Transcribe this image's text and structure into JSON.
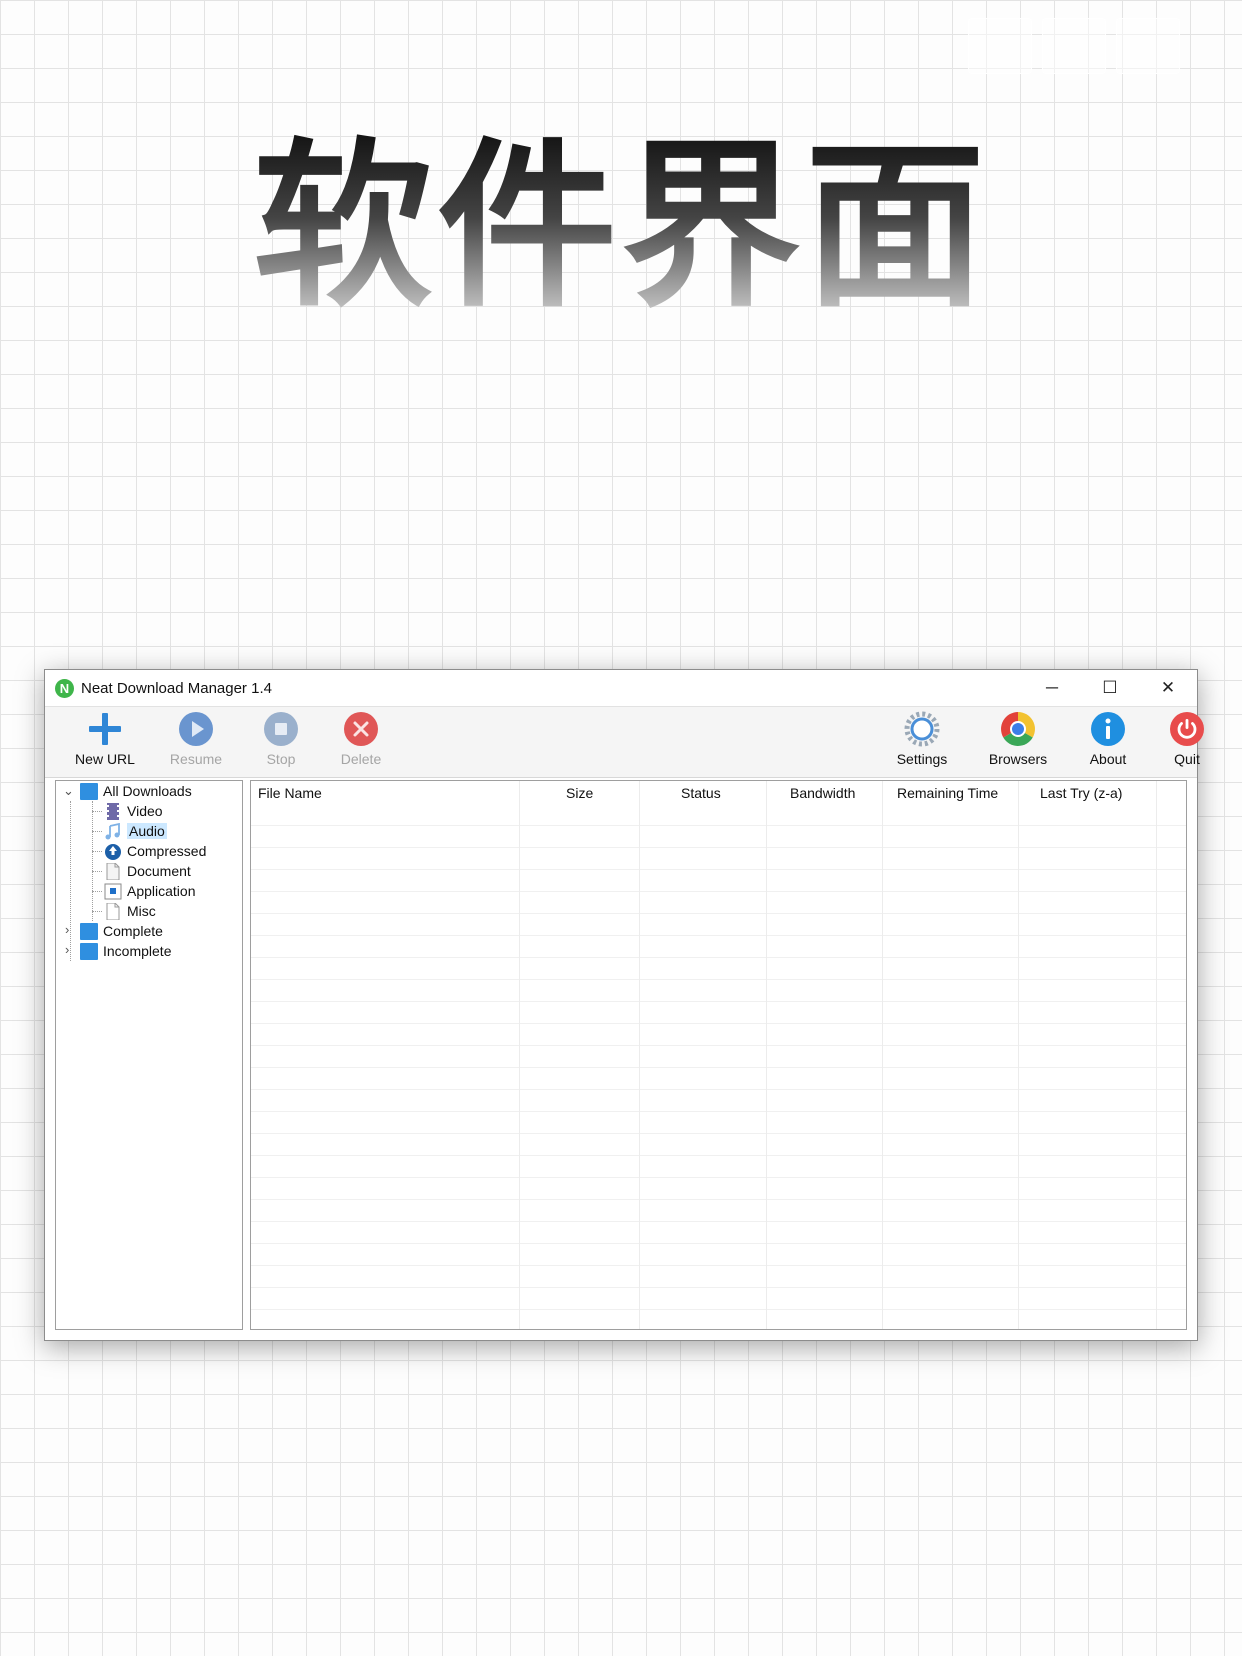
{
  "banner": {
    "title": "软件界面"
  },
  "window": {
    "title": "Neat Download Manager 1.4",
    "app_icon_letter": "N",
    "controls": {
      "minimize": "─",
      "maximize": "☐",
      "close": "✕"
    }
  },
  "toolbar": {
    "new_url": "New URL",
    "resume": "Resume",
    "stop": "Stop",
    "delete": "Delete",
    "settings": "Settings",
    "browsers": "Browsers",
    "about": "About",
    "quit": "Quit"
  },
  "tree": {
    "all_downloads": "All Downloads",
    "video": "Video",
    "audio": "Audio",
    "compressed": "Compressed",
    "document": "Document",
    "application": "Application",
    "misc": "Misc",
    "complete": "Complete",
    "incomplete": "Incomplete",
    "selected": "Audio"
  },
  "columns": {
    "file_name": "File Name",
    "size": "Size",
    "status": "Status",
    "bandwidth": "Bandwidth",
    "remaining_time": "Remaining Time",
    "last_try": "Last Try (z-a)"
  },
  "colors": {
    "new_url": "#2f86d6",
    "resume": "#6a95cf",
    "stop": "#9ab0cc",
    "delete": "#e05757",
    "about": "#1f8fe0",
    "quit": "#e84c4c",
    "folder": "#2f8fe0",
    "selection": "#cce8ff"
  }
}
